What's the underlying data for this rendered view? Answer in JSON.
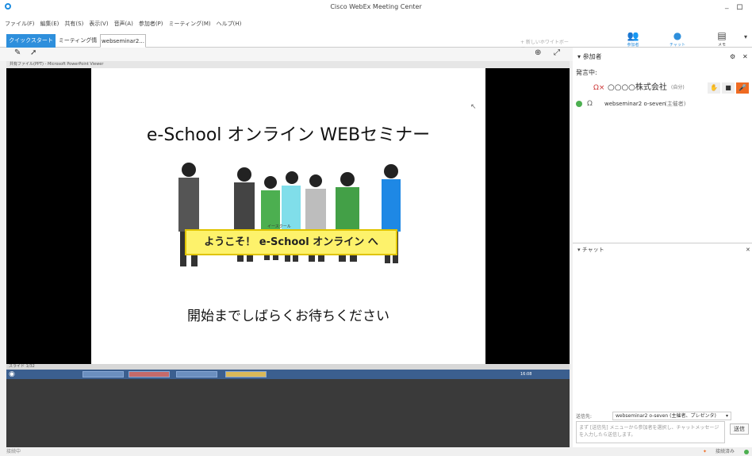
{
  "window": {
    "title": "Cisco WebEx Meeting Center",
    "minimize": "_",
    "restore": "ロ"
  },
  "menu": [
    "ファイル(F)",
    "編集(E)",
    "共有(S)",
    "表示(V)",
    "音声(A)",
    "参加者(P)",
    "ミーティング(M)",
    "ヘルプ(H)"
  ],
  "tabs": {
    "quick_start": "クイックスタート",
    "meeting_info": "ミーティング情報",
    "active": "webseminar2..."
  },
  "new_whiteboard": "+ 新しいホワイトボード",
  "right_buttons": {
    "participants": "参加者",
    "chat": "チャット",
    "notes": "メモ"
  },
  "ppt_bar": "共有ファイル(PPT) - Microsoft PowerPoint Viewer",
  "slide": {
    "title": "e-School オンライン WEBセミナー",
    "banner": "ようこそ！ e-School オンライン へ",
    "banner_ruby": "イースクール",
    "subtitle": "開始までしばらくお待ちください"
  },
  "slide_counter": "スライド 1/32",
  "taskbar": {
    "clock": "16:08"
  },
  "participants_panel": {
    "header": "参加者",
    "speaking_label": "発言中:",
    "presenter": {
      "name": "○○○○株式会社",
      "tag": "(自分)"
    },
    "host": {
      "name": "webseminar2 o-seven",
      "tag": "(主催者)"
    }
  },
  "chat_panel": {
    "header": "チャット",
    "to_label": "送信先:",
    "to_value": "webseminar2 o-seven (主催者、プレゼンタ)",
    "input_placeholder": "まず [送信先] メニューから参加者を選択し、チャットメッセージを入力したら送信します。",
    "send_button": "送信"
  },
  "status": {
    "left": "接続中",
    "right": "接続済み"
  },
  "colors": {
    "accent": "#2e8fdc",
    "banner": "#fdf26b",
    "mute_active": "#ef6b22"
  }
}
